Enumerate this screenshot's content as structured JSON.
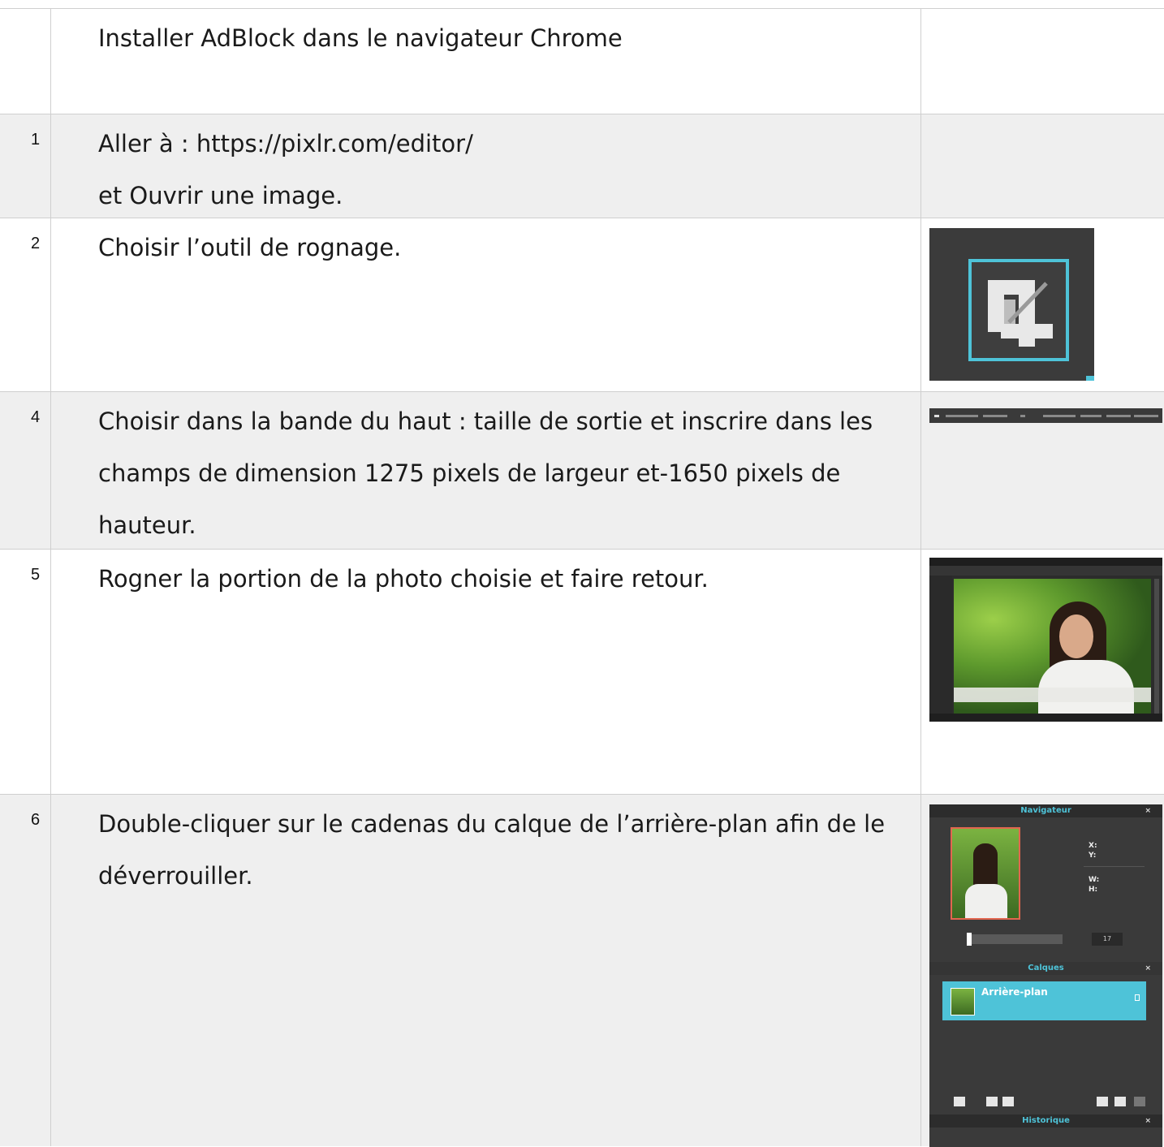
{
  "rows": [
    {
      "num": "",
      "lines": [
        "Installer AdBlock dans le navigateur Chrome"
      ]
    },
    {
      "num": "1",
      "lines": [
        "Aller à :  https://pixlr.com/editor/",
        "et Ouvrir une image."
      ]
    },
    {
      "num": "2",
      "lines": [
        "Choisir l’outil de rognage."
      ]
    },
    {
      "num": "4",
      "lines": [
        "Choisir dans la bande du haut : taille de sortie et inscrire dans les",
        "champs de dimension 1275 pixels de largeur et-1650 pixels de",
        "hauteur."
      ]
    },
    {
      "num": "5",
      "lines": [
        "Rogner la portion de la photo choisie et faire retour."
      ]
    },
    {
      "num": "6",
      "lines": [
        "Double-cliquer sur le cadenas du calque de l’arrière-plan afin de le",
        "déverrouiller."
      ]
    }
  ],
  "panel": {
    "navigator_title": "Navigateur",
    "x_label": "X:",
    "y_label": "Y:",
    "w_label": "W:",
    "h_label": "H:",
    "zoom_value": "17",
    "layers_title": "Calques",
    "layer_name": "Arrière-plan",
    "history_title": "Historique",
    "close_glyph": "×"
  },
  "colors": {
    "accent": "#4ec3d8",
    "row_shaded": "#efefef",
    "grid": "#cfcfcf"
  }
}
